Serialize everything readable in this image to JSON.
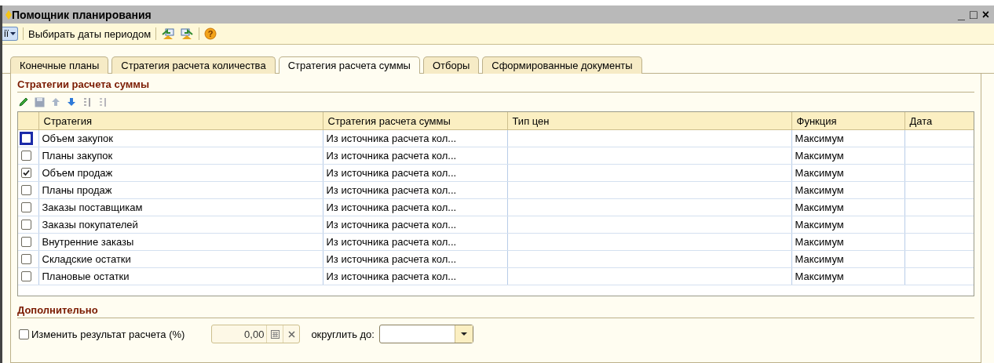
{
  "window": {
    "title": "Помощник планирования",
    "controls": [
      "_",
      "□",
      "×"
    ]
  },
  "toolbar": {
    "actions_menu": "ії",
    "items": [
      {
        "kind": "text",
        "label": "Выбирать даты периодом"
      },
      {
        "kind": "icon"
      },
      {
        "kind": "icon"
      },
      {
        "kind": "help",
        "label": "?"
      }
    ]
  },
  "tabs": [
    {
      "label": "Конечные планы",
      "selected": false
    },
    {
      "label": "Стратегия расчета количества",
      "selected": false
    },
    {
      "label": "Стратегия расчета суммы",
      "selected": true
    },
    {
      "label": "Отборы",
      "selected": false
    },
    {
      "label": "Сформированные документы",
      "selected": false
    }
  ],
  "strategies": {
    "title": "Стратегии расчета суммы",
    "columns": [
      "Стратегия",
      "Стратегия расчета суммы",
      "Тип цен",
      "Функция",
      "Дата"
    ],
    "rows": [
      {
        "checked": false,
        "focused": true,
        "name": "Объем закупок",
        "sum_strategy": "Из источника расчета кол...",
        "price_type": "",
        "function": "Максимум",
        "date": ""
      },
      {
        "checked": false,
        "focused": false,
        "name": "Планы закупок",
        "sum_strategy": "Из источника расчета кол...",
        "function": "Максимум"
      },
      {
        "checked": true,
        "focused": false,
        "name": "Объем продаж",
        "sum_strategy": "Из источника расчета кол...",
        "function": "Максимум"
      },
      {
        "checked": false,
        "focused": false,
        "name": "Планы продаж",
        "sum_strategy": "Из источника расчета кол...",
        "function": "Максимум"
      },
      {
        "checked": false,
        "focused": false,
        "name": "Заказы поставщикам",
        "sum_strategy": "Из источника расчета кол...",
        "function": "Максимум"
      },
      {
        "checked": false,
        "focused": false,
        "name": "Заказы покупателей",
        "sum_strategy": "Из источника расчета кол...",
        "function": "Максимум"
      },
      {
        "checked": false,
        "focused": false,
        "name": "Внутренние заказы",
        "sum_strategy": "Из источника расчета кол...",
        "function": "Максимум"
      },
      {
        "checked": false,
        "focused": false,
        "name": "Складские остатки",
        "sum_strategy": "Из источника расчета кол...",
        "function": "Максимум"
      },
      {
        "checked": false,
        "focused": false,
        "name": "Плановые остатки",
        "sum_strategy": "Из источника расчета кол...",
        "function": "Максимум"
      }
    ]
  },
  "additional": {
    "title": "Дополнительно",
    "change_result": {
      "label": "Изменить результат расчета (%)",
      "checked": false
    },
    "percent": {
      "value": "0,00"
    },
    "round_label": "округлить до:"
  }
}
